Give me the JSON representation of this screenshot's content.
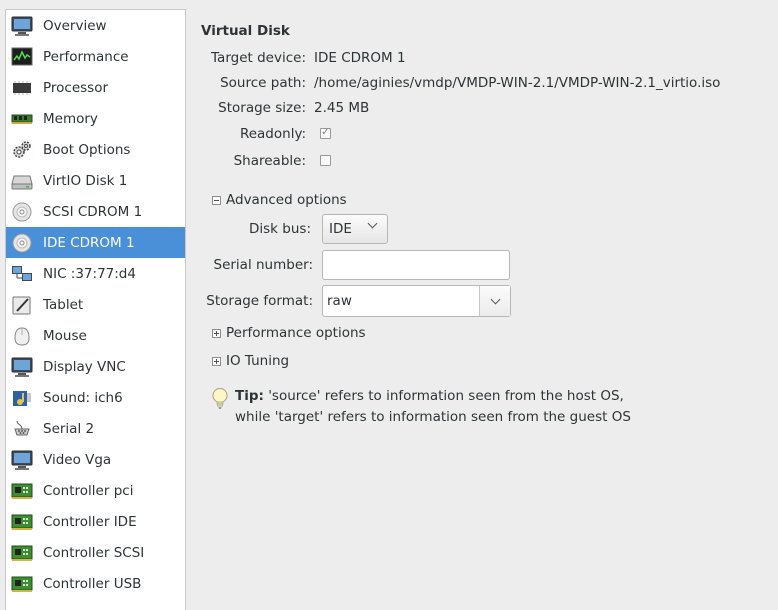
{
  "sidebar": {
    "items": [
      {
        "label": "Overview",
        "icon": "monitor-icon"
      },
      {
        "label": "Performance",
        "icon": "performance-chart-icon"
      },
      {
        "label": "Processor",
        "icon": "cpu-chip-icon"
      },
      {
        "label": "Memory",
        "icon": "memory-ram-icon"
      },
      {
        "label": "Boot Options",
        "icon": "gears-icon"
      },
      {
        "label": "VirtIO Disk 1",
        "icon": "hard-disk-icon"
      },
      {
        "label": "SCSI CDROM 1",
        "icon": "cdrom-icon"
      },
      {
        "label": "IDE CDROM 1",
        "icon": "cdrom-icon",
        "selected": true
      },
      {
        "label": "NIC :37:77:d4",
        "icon": "network-icon"
      },
      {
        "label": "Tablet",
        "icon": "tablet-icon"
      },
      {
        "label": "Mouse",
        "icon": "mouse-icon"
      },
      {
        "label": "Display VNC",
        "icon": "display-icon"
      },
      {
        "label": "Sound: ich6",
        "icon": "sound-card-icon"
      },
      {
        "label": "Serial 2",
        "icon": "serial-port-icon"
      },
      {
        "label": "Video Vga",
        "icon": "video-card-icon"
      },
      {
        "label": "Controller pci",
        "icon": "controller-card-icon"
      },
      {
        "label": "Controller IDE",
        "icon": "controller-card-icon"
      },
      {
        "label": "Controller SCSI",
        "icon": "controller-card-icon"
      },
      {
        "label": "Controller USB",
        "icon": "controller-card-icon"
      }
    ]
  },
  "disk": {
    "section_title": "Virtual Disk",
    "target_device_label": "Target device:",
    "target_device_value": "IDE CDROM 1",
    "source_path_label": "Source path:",
    "source_path_value": "/home/aginies/vmdp/VMDP-WIN-2.1/VMDP-WIN-2.1_virtio.iso",
    "storage_size_label": "Storage size:",
    "storage_size_value": "2.45 MB",
    "readonly_label": "Readonly:",
    "readonly_checked": true,
    "shareable_label": "Shareable:",
    "shareable_checked": false
  },
  "advanced": {
    "expander_label": "Advanced options",
    "disk_bus_label": "Disk bus:",
    "disk_bus_value": "IDE",
    "serial_number_label": "Serial number:",
    "serial_number_value": "",
    "storage_format_label": "Storage format:",
    "storage_format_value": "raw"
  },
  "performance_expander_label": "Performance options",
  "io_tuning_expander_label": "IO Tuning",
  "tip": {
    "prefix": "Tip:",
    "line1": " 'source' refers to information seen from the host OS,",
    "line2": "while 'target' refers to information seen from the guest OS"
  },
  "colors": {
    "selection": "#4a90d9",
    "background": "#ededed"
  }
}
